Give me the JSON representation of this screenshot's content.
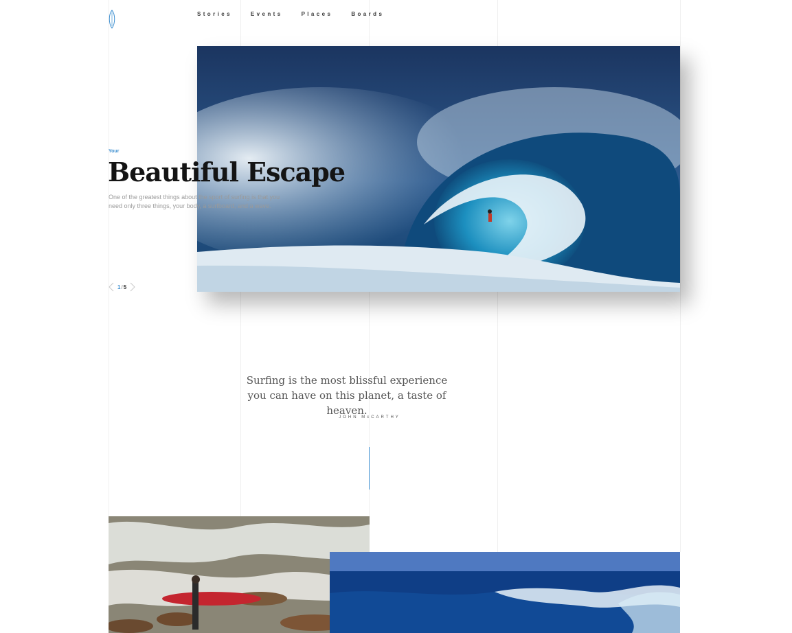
{
  "nav": {
    "items": [
      "Stories",
      "Events",
      "Places",
      "Boards"
    ]
  },
  "hero": {
    "eyebrow": "Your",
    "title": "Beautiful Escape",
    "description": "One of the greatest things about the sport of surfing is that you need only three things, your body, a surfboard, and a wave."
  },
  "pager": {
    "current": "1",
    "separator": "/",
    "total": "5"
  },
  "quote": {
    "text": "Surfing is the most blissful experience you can have on this planet, a taste of heaven.",
    "author": "JOHN McCARTHY"
  },
  "colors": {
    "accent": "#3d8fd0",
    "title": "#141414",
    "muted": "#9a9a9a"
  }
}
